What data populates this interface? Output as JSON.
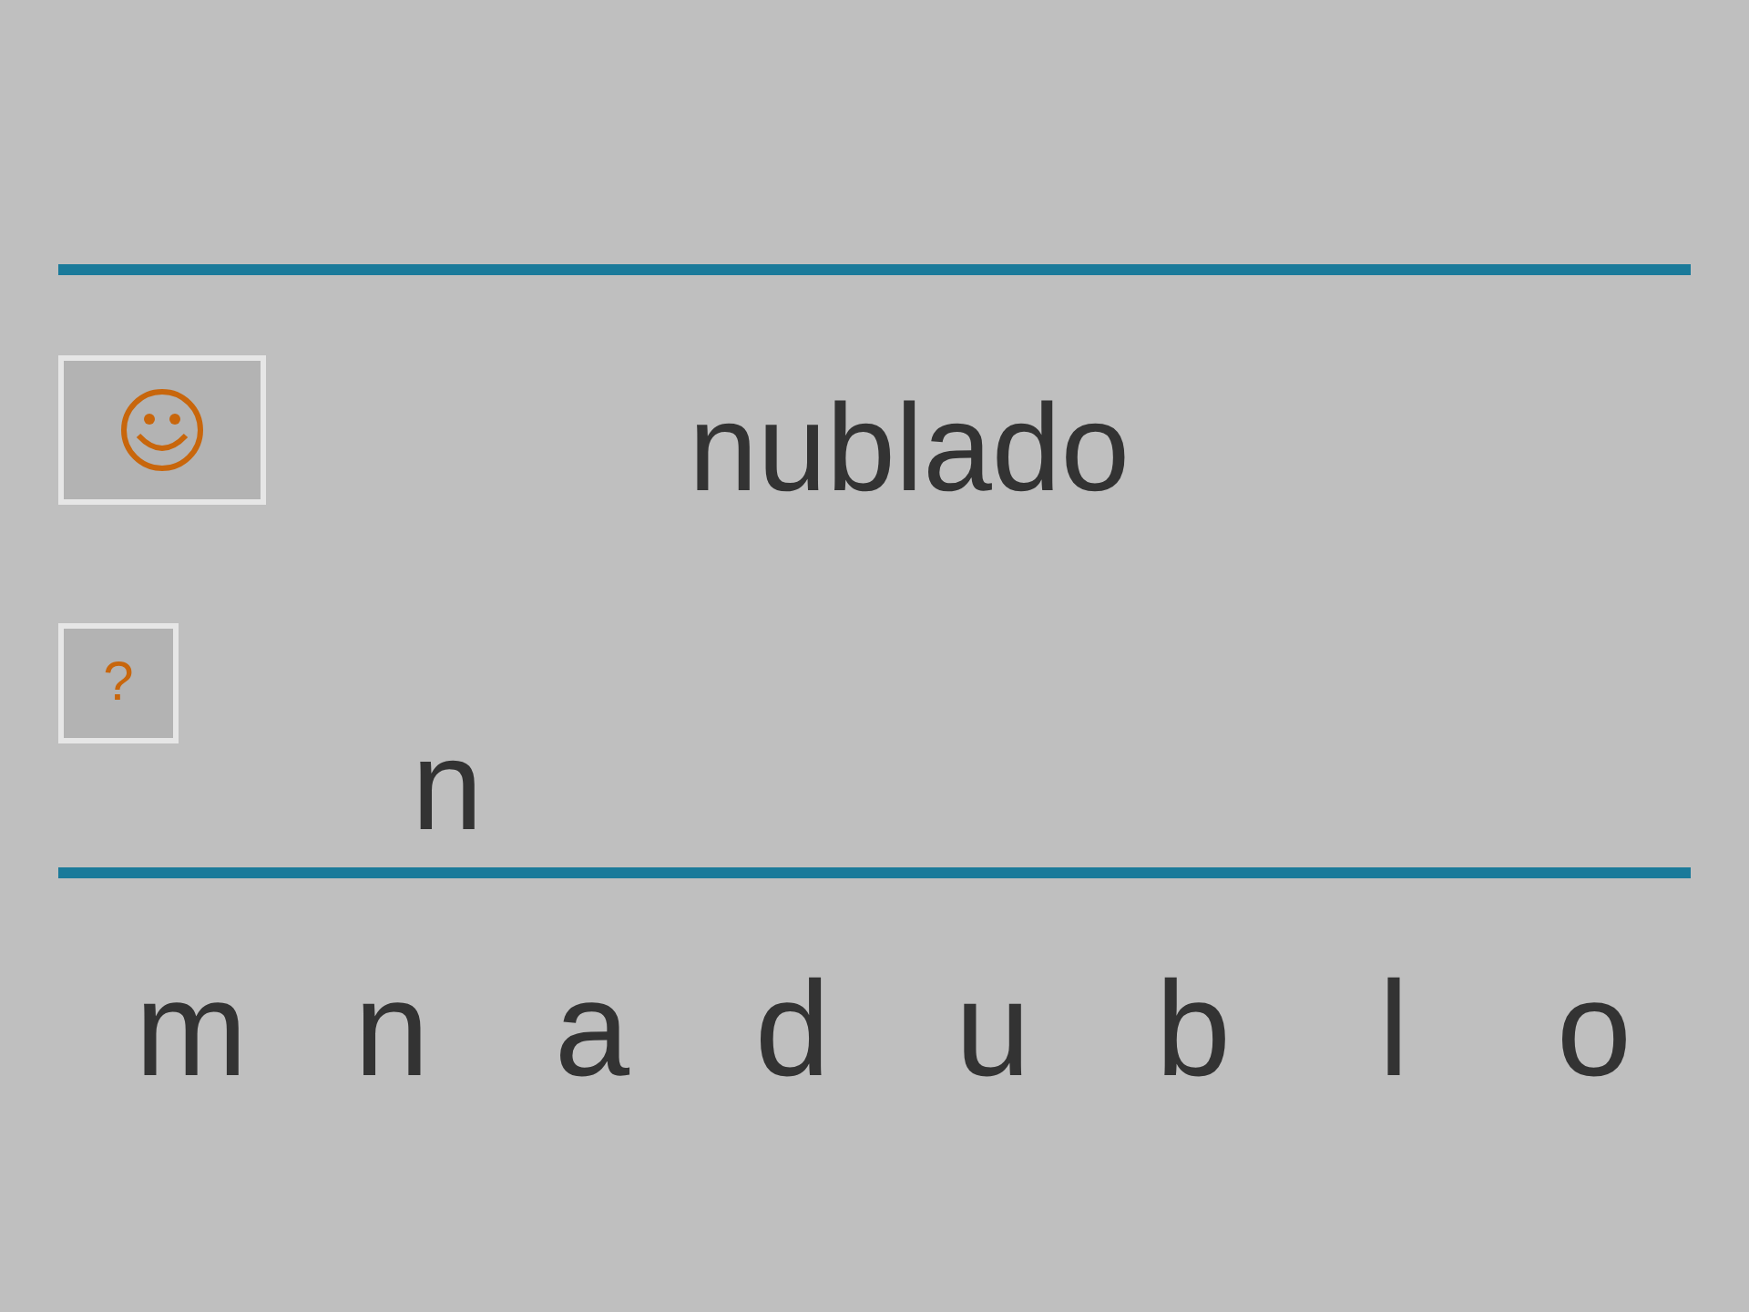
{
  "word": "nublado",
  "help_button": {
    "label": "?"
  },
  "answer": "n",
  "letters": [
    "m",
    "n",
    "a",
    "d",
    "u",
    "b",
    "l",
    "o"
  ]
}
